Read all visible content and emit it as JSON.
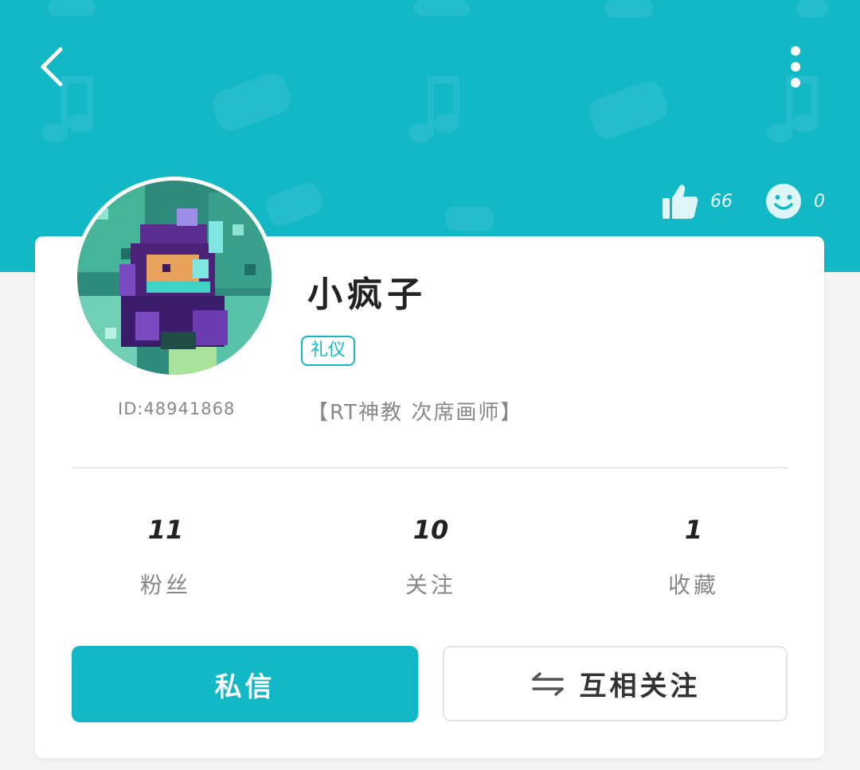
{
  "colors": {
    "accent": "#13b8c7",
    "text_dark": "#222222",
    "text_muted": "#888888"
  },
  "header": {
    "back_icon": "chevron-left-icon",
    "more_icon": "more-vertical-icon",
    "likes": {
      "icon": "thumbs-up-icon",
      "count": "66"
    },
    "smiles": {
      "icon": "smiley-icon",
      "count": "0"
    }
  },
  "profile": {
    "avatar": "pixel-art-character-avatar",
    "name": "小疯子",
    "tag": "礼仪",
    "id_text": "ID:48941868",
    "bio": "【RT神教 次席画师】"
  },
  "stats": [
    {
      "value": "11",
      "label": "粉丝"
    },
    {
      "value": "10",
      "label": "关注"
    },
    {
      "value": "1",
      "label": "收藏"
    }
  ],
  "actions": {
    "message_label": "私信",
    "follow_label": "互相关注",
    "follow_icon": "swap-arrows-icon"
  }
}
